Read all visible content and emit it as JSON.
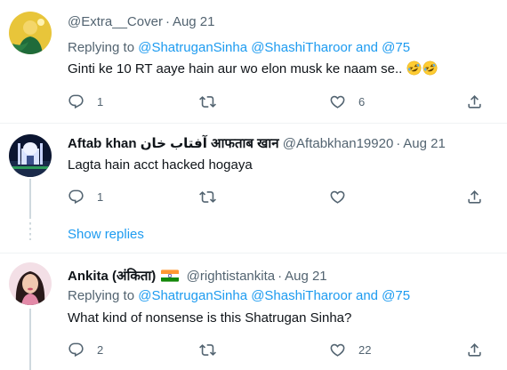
{
  "tweets": [
    {
      "name": "",
      "handle": "@Extra__Cover",
      "time": "Aug 21",
      "reply_prefix": "Replying to",
      "reply_users": "@ShatruganSinha @ShashiTharoor and @75",
      "text": "Ginti ke 10 RT aaye hain aur wo elon musk ke naam se..",
      "emoji": "rolling-on-the-floor-laughing",
      "counts": {
        "reply": "1",
        "retweet": "",
        "like": "6"
      }
    },
    {
      "name": "Aftab khan آفتاب خان आफताब खान",
      "handle": "@Aftabkhan19920",
      "time": "Aug 21",
      "text": "Lagta hain acct hacked hogaya",
      "counts": {
        "reply": "1",
        "retweet": "",
        "like": ""
      }
    },
    {
      "name": "Ankita (अंकिता)",
      "handle": "@rightistankita",
      "time": "Aug 21",
      "reply_prefix": "Replying to",
      "reply_users": "@ShatruganSinha @ShashiTharoor and @75",
      "text": "What kind of nonsense is this Shatrugan Sinha?",
      "counts": {
        "reply": "2",
        "retweet": "",
        "like": "22"
      }
    }
  ],
  "show_replies": "Show replies",
  "icons": [
    "reply-icon",
    "retweet-icon",
    "like-icon",
    "share-icon",
    "india-flag-icon",
    "laughing-emoji-icon"
  ],
  "colors": {
    "link": "#1d9bf0",
    "secondary": "#536471",
    "text": "#0f1419",
    "line": "#cfd9de"
  }
}
